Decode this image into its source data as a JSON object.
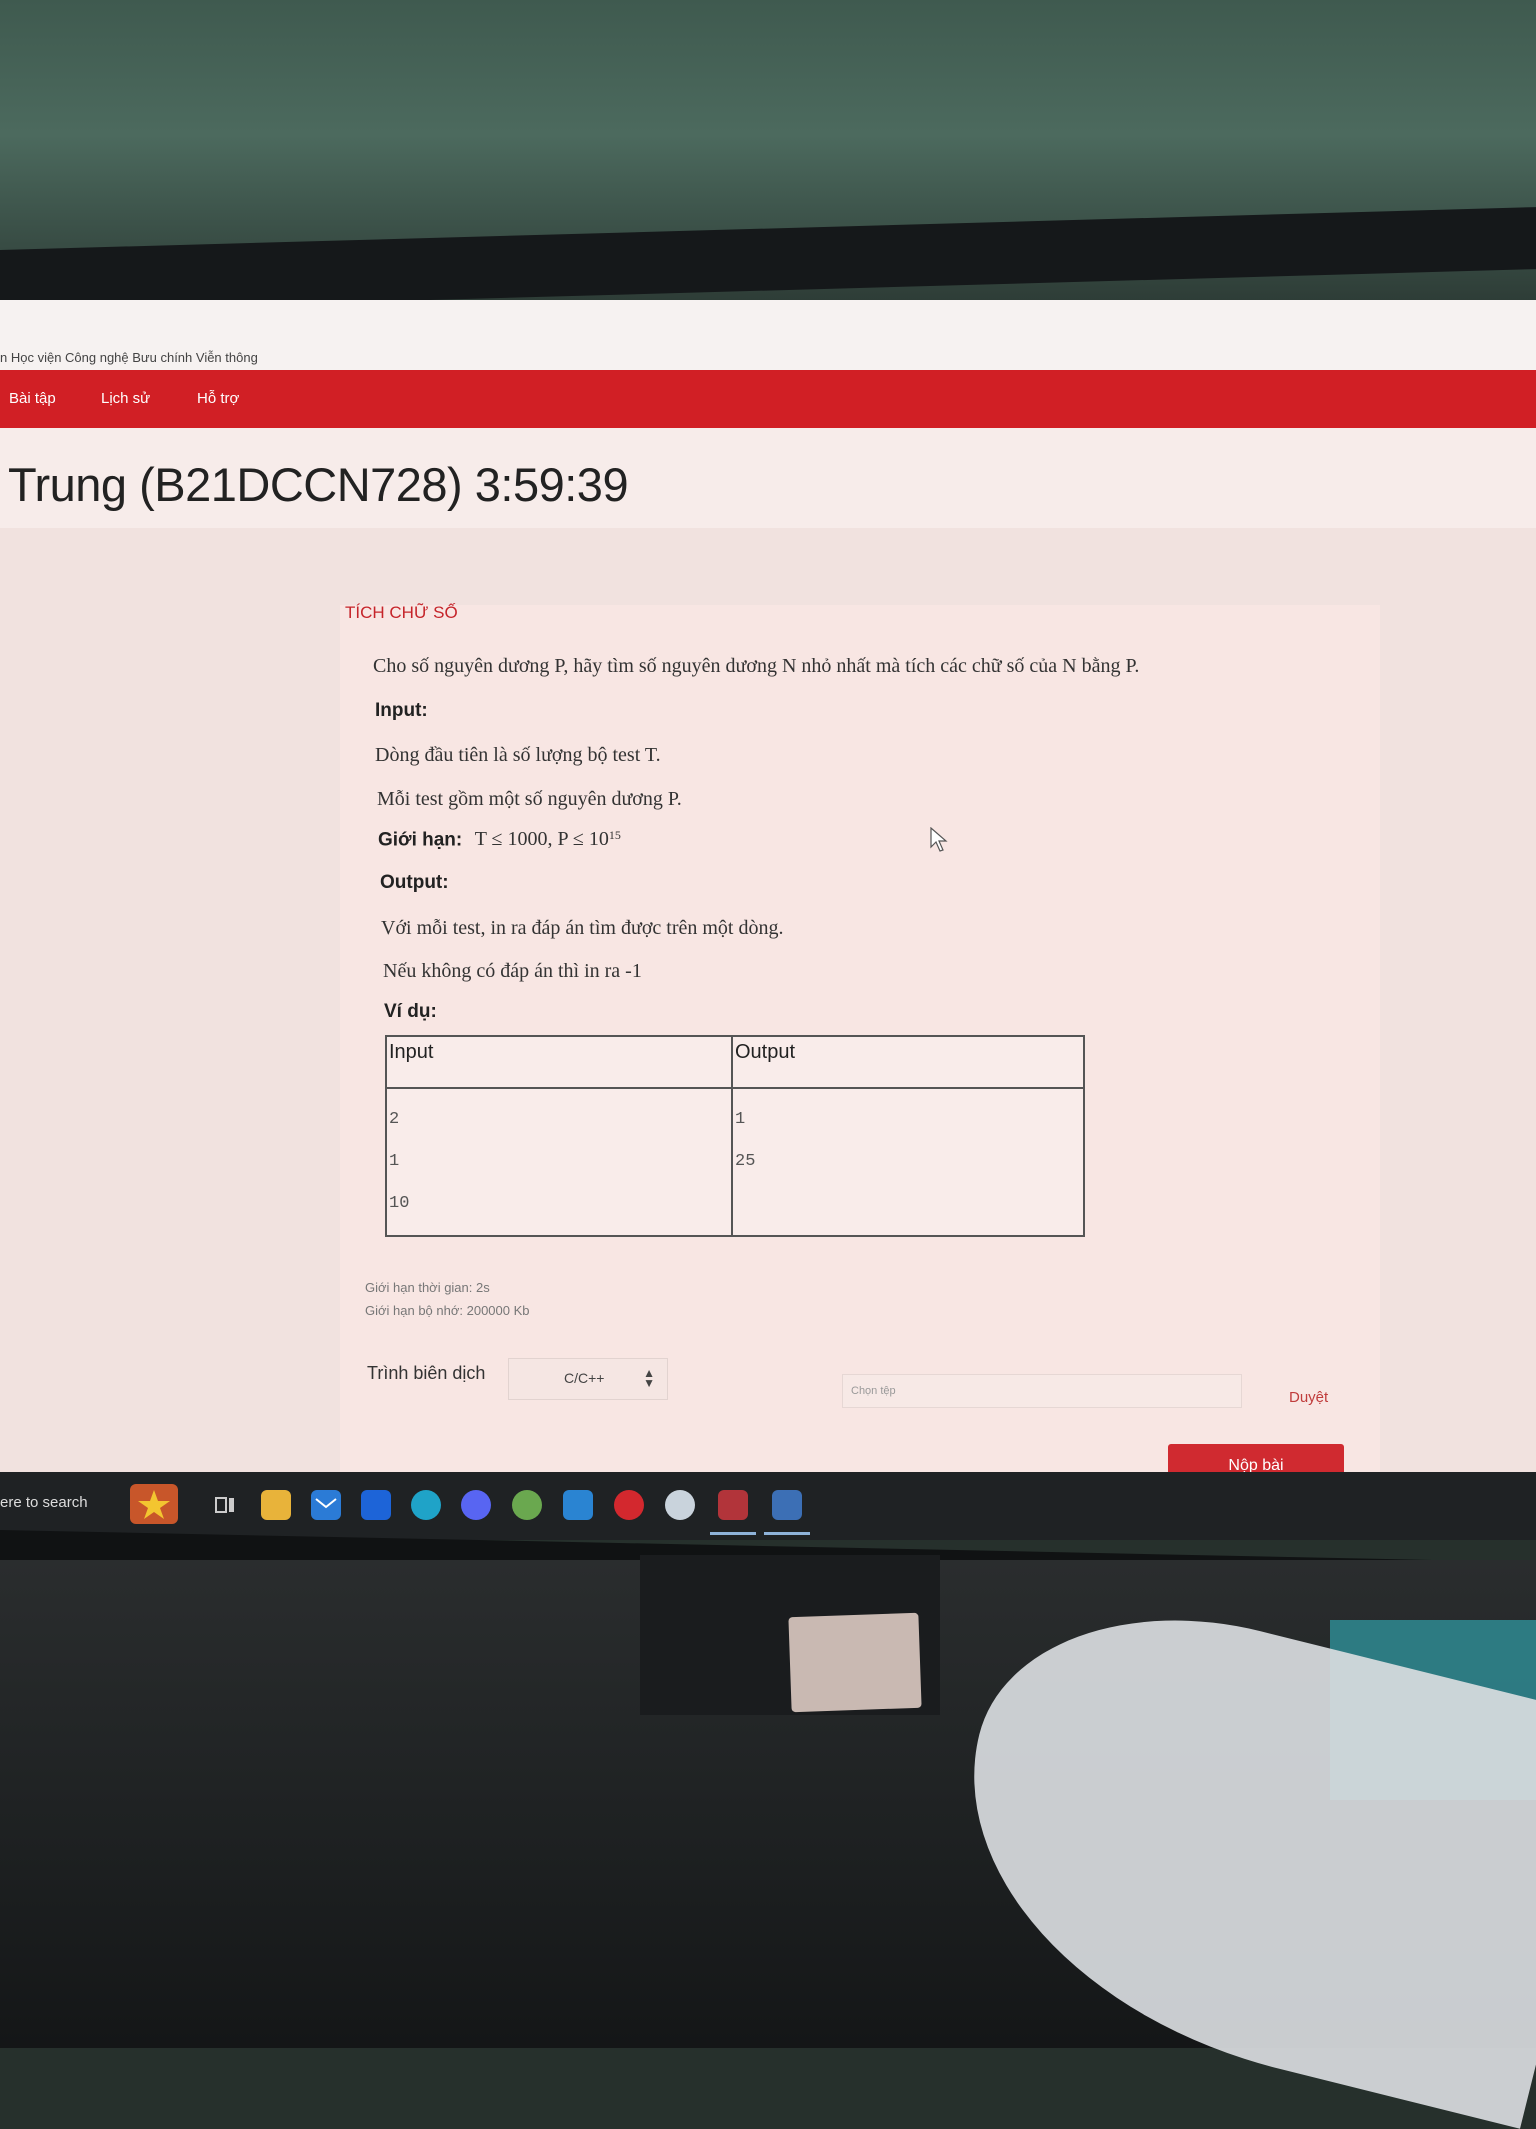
{
  "window": {
    "title": "n Học viện Công nghệ Bưu chính Viễn thông"
  },
  "nav": {
    "items": [
      "Bài tập",
      "Lịch sử",
      "Hỗ trợ"
    ]
  },
  "header": {
    "title": "Trung (B21DCCN728) 3:59:39"
  },
  "problem": {
    "title": "TÍCH CHỮ SỐ",
    "statement": "Cho số nguyên dương P, hãy tìm số nguyên dương N nhỏ nhất mà tích các chữ số của N bằng P.",
    "input_label": "Input:",
    "input_line1": "Dòng đầu tiên là số lượng bộ test T.",
    "input_line2": "Mỗi test gồm một số nguyên dương P.",
    "limits_label": "Giới hạn:",
    "limits_text": "T ≤ 1000, P ≤ 10",
    "limits_exp": "15",
    "output_label": "Output:",
    "output_line1": "Với mỗi test, in ra đáp án tìm được trên một dòng.",
    "output_line2": "Nếu không có đáp án thì in ra -1",
    "example_label": "Ví dụ:"
  },
  "example": {
    "headers": [
      "Input",
      "Output"
    ],
    "input_lines": [
      "2",
      "1",
      "10"
    ],
    "output_lines": [
      "1",
      "25"
    ]
  },
  "limits": {
    "time": "Giới hạn thời gian: 2s",
    "memory": "Giới hạn bộ nhớ: 200000 Kb"
  },
  "submit_form": {
    "compiler_label": "Trình biên dịch",
    "compiler_value": "C/C++",
    "file_placeholder": "Chọn tệp",
    "browse_label": "Duyệt",
    "submit_label": "Nộp bài"
  },
  "taskbar": {
    "search_text": "ere to search",
    "icons": [
      "weather-icon",
      "task-view-icon",
      "file-explorer-icon",
      "mail-icon",
      "dropbox-icon",
      "edge-icon",
      "discord-icon",
      "chrome-icon",
      "vscode-icon",
      "app-red-icon",
      "steam-icon",
      "app-active-icon",
      "dev-icon"
    ]
  }
}
